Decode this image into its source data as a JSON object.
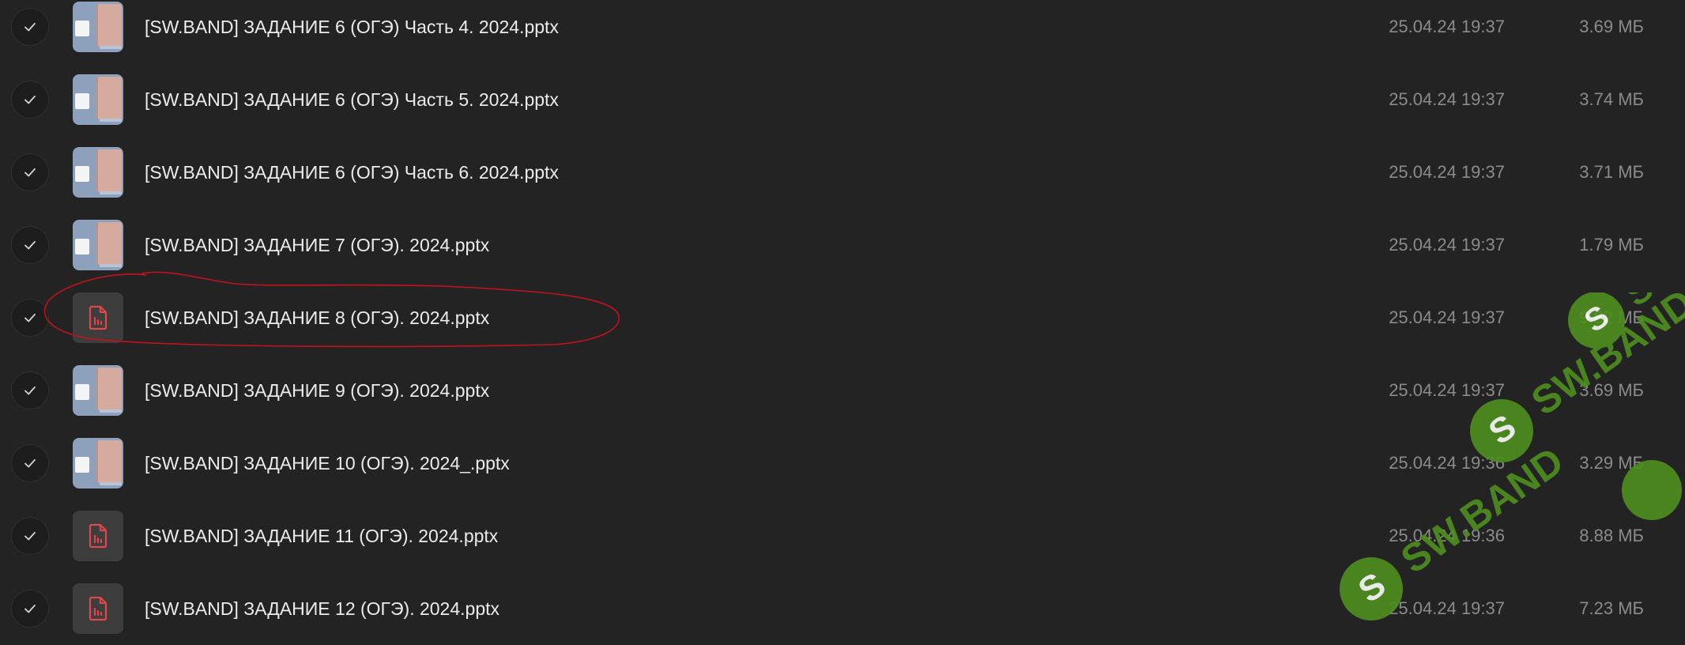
{
  "files": [
    {
      "name": "[SW.BAND] ЗАДАНИЕ 6 (ОГЭ) Часть 4. 2024.pptx",
      "date": "25.04.24 19:37",
      "size": "3.69 МБ",
      "thumb": "preview"
    },
    {
      "name": "[SW.BAND] ЗАДАНИЕ 6 (ОГЭ) Часть 5. 2024.pptx",
      "date": "25.04.24 19:37",
      "size": "3.74 МБ",
      "thumb": "preview"
    },
    {
      "name": "[SW.BAND] ЗАДАНИЕ 6 (ОГЭ) Часть 6. 2024.pptx",
      "date": "25.04.24 19:37",
      "size": "3.71 МБ",
      "thumb": "preview"
    },
    {
      "name": "[SW.BAND] ЗАДАНИЕ 7 (ОГЭ). 2024.pptx",
      "date": "25.04.24 19:37",
      "size": "1.79 МБ",
      "thumb": "preview"
    },
    {
      "name": "[SW.BAND] ЗАДАНИЕ 8 (ОГЭ). 2024.pptx",
      "date": "25.04.24 19:37",
      "size": "9.82 МБ",
      "thumb": "generic"
    },
    {
      "name": "[SW.BAND] ЗАДАНИЕ 9 (ОГЭ). 2024.pptx",
      "date": "25.04.24 19:37",
      "size": "3.69 МБ",
      "thumb": "preview"
    },
    {
      "name": "[SW.BAND] ЗАДАНИЕ 10 (ОГЭ). 2024_.pptx",
      "date": "25.04.24 19:36",
      "size": "3.29 МБ",
      "thumb": "preview"
    },
    {
      "name": "[SW.BAND] ЗАДАНИЕ 11 (ОГЭ). 2024.pptx",
      "date": "25.04.24 19:36",
      "size": "8.88 МБ",
      "thumb": "generic"
    },
    {
      "name": "[SW.BAND] ЗАДАНИЕ 12 (ОГЭ). 2024.pptx",
      "date": "25.04.24 19:37",
      "size": "7.23 МБ",
      "thumb": "generic"
    }
  ],
  "icons": {
    "check": "check-icon",
    "generic_file": "presentation-file-icon"
  },
  "colors": {
    "background": "#232323",
    "file_icon_accent": "#e0474c",
    "annotation_stroke": "#c4121c",
    "watermark_green": "#4e8f1f"
  },
  "watermark": {
    "text": "SW.BAND"
  }
}
